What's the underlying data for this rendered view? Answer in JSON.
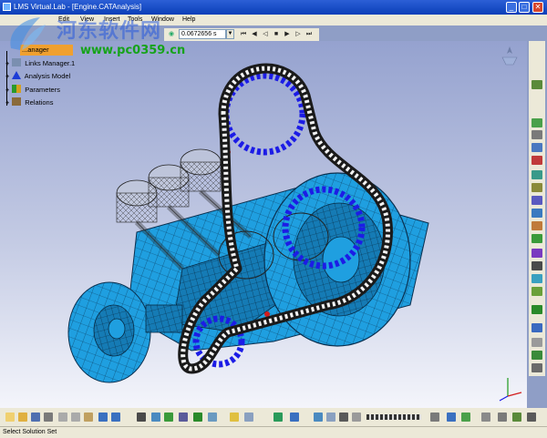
{
  "window": {
    "title": "LMS Virtual.Lab - [Engine.CATAnalysis]",
    "minimize": "_",
    "maximize": "□",
    "close": "✕"
  },
  "menu": [
    {
      "label": "Edit"
    },
    {
      "label": "View"
    },
    {
      "label": "Insert"
    },
    {
      "label": "Tools"
    },
    {
      "label": "Window"
    },
    {
      "label": "Help"
    }
  ],
  "simulation": {
    "time_value": "0.0672656 s",
    "controls": [
      "first-frame",
      "previous-frame",
      "play-backward",
      "stop",
      "play",
      "next-frame",
      "last-frame",
      "settings"
    ]
  },
  "watermark": {
    "chinese": "河东软件网",
    "url": "www.pc0359.cn"
  },
  "tree": {
    "root": "...anager",
    "items": [
      {
        "label": "Links Manager.1",
        "icon": "links-icon"
      },
      {
        "label": "Analysis Model",
        "icon": "analysis-model-icon"
      },
      {
        "label": "Parameters",
        "icon": "parameters-icon"
      },
      {
        "label": "Relations",
        "icon": "relations-icon"
      }
    ]
  },
  "model": {
    "description_colors": {
      "mesh": "#1f9fe0",
      "mesh_dark": "#0c5e94",
      "chain_plates": "#1a1a1a",
      "chain_rollers": "#f4f4f4",
      "sprocket_teeth": "#1c1ce6",
      "background_top": "#9aa6d2",
      "background_bottom": "#ffffff"
    }
  },
  "status": {
    "text": "Select Solution Set"
  },
  "colors": {
    "titlebar": "#0a3fb8",
    "toolbar_bg": "#ece9d8",
    "tree_selected": "#f0a030"
  }
}
